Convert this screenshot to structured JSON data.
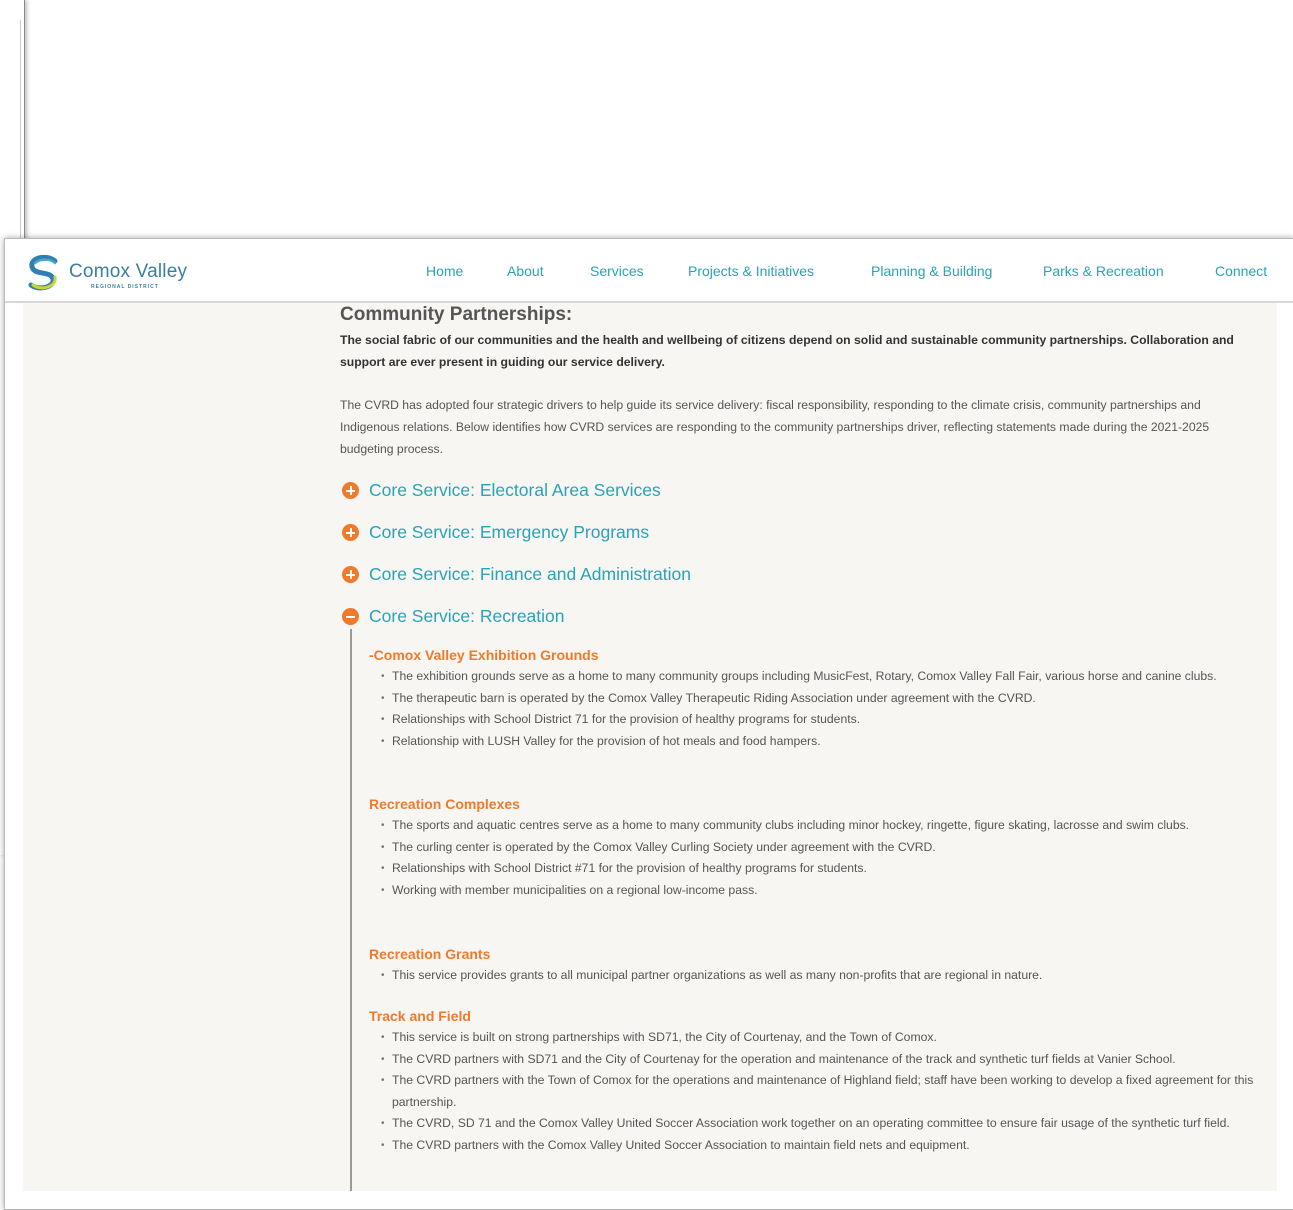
{
  "logo": {
    "name": "Comox Valley",
    "sub": "REGIONAL DISTRICT"
  },
  "nav": [
    "Home",
    "About",
    "Services",
    "Projects & Initiatives",
    "Planning & Building",
    "Parks & Recreation",
    "Connect"
  ],
  "page": {
    "heading": "Community Partnerships:",
    "lead": "The social fabric of our communities and the health and wellbeing of citizens depend on solid and sustainable community partnerships. Collaboration and support are ever present in guiding our service delivery.",
    "body": "The CVRD has adopted four strategic drivers to help guide its service delivery: fiscal responsibility, responding to the climate crisis, community partnerships and Indigenous relations. Below identifies how CVRD services are responding to the community partnerships driver, reflecting statements made during the 2021-2025 budgeting process."
  },
  "accordions": [
    {
      "title": "Core Service: Electoral Area Services",
      "state": "collapsed"
    },
    {
      "title": "Core Service: Emergency Programs",
      "state": "collapsed"
    },
    {
      "title": "Core Service: Finance and Administration",
      "state": "collapsed"
    },
    {
      "title": "Core Service: Recreation",
      "state": "expanded"
    }
  ],
  "recreation_sections": [
    {
      "heading": "-Comox Valley Exhibition Grounds",
      "items": [
        "The exhibition grounds serve as a home to many community groups including MusicFest, Rotary, Comox Valley Fall Fair, various horse and canine clubs.",
        "The therapeutic barn is operated by the Comox Valley Therapeutic Riding Association under agreement with the CVRD.",
        "Relationships with School District 71 for the provision of healthy programs for students.",
        "Relationship with LUSH Valley for the provision of hot meals and food hampers."
      ]
    },
    {
      "heading": "Recreation Complexes",
      "items": [
        "The sports and aquatic centres serve as a home to many community clubs including minor hockey, ringette, figure skating, lacrosse and swim clubs.",
        "The curling center is operated by the Comox Valley Curling Society under agreement with the CVRD.",
        "Relationships with School District #71 for the provision of healthy programs for students.",
        "Working with member municipalities on a regional low-income pass."
      ]
    },
    {
      "heading": "Recreation Grants",
      "items": [
        "This service provides grants to all municipal partner organizations as well as many non-profits that are regional in nature."
      ]
    },
    {
      "heading": "Track and Field",
      "items": [
        "This service is built on strong partnerships with SD71, the City of Courtenay, and the Town of Comox.",
        "The CVRD partners with SD71 and the City of Courtenay for the operation and maintenance of the track and synthetic turf fields at Vanier School.",
        "The CVRD partners with the Town of Comox for the operations and maintenance of Highland field; staff have been working to develop a fixed agreement for this partnership.",
        "The CVRD, SD 71 and the Comox Valley United Soccer Association work together on an operating committee to ensure fair usage of the synthetic turf field.",
        "The CVRD partners with the Comox Valley United Soccer Association to maintain field nets and equipment."
      ]
    }
  ],
  "colors": {
    "accent_teal": "#2aa3b6",
    "accent_orange": "#f07a2c",
    "content_bg": "#f7f6f3"
  }
}
